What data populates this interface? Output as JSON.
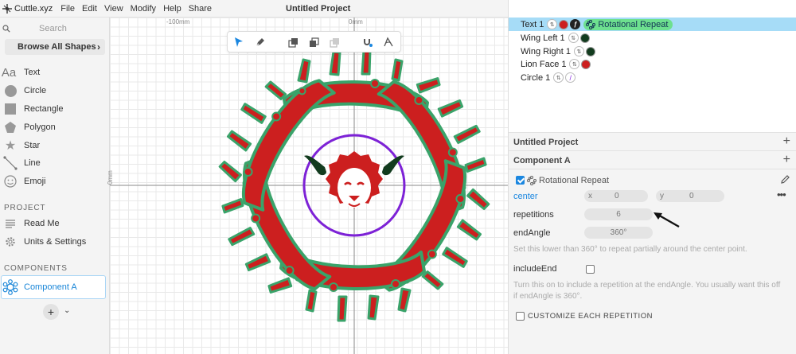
{
  "app": {
    "brand": "Cuttle.xyz",
    "menus": [
      "File",
      "Edit",
      "View",
      "Modify",
      "Help",
      "Share"
    ],
    "project_title": "Untitled Project"
  },
  "sidebar": {
    "search_placeholder": "Search",
    "browse_label": "Browse All Shapes",
    "shapes": [
      {
        "label": "Text",
        "icon": "text-aa-icon"
      },
      {
        "label": "Circle",
        "icon": "circle-icon"
      },
      {
        "label": "Rectangle",
        "icon": "rectangle-icon"
      },
      {
        "label": "Polygon",
        "icon": "polygon-icon"
      },
      {
        "label": "Star",
        "icon": "star-icon"
      },
      {
        "label": "Line",
        "icon": "line-icon"
      },
      {
        "label": "Emoji",
        "icon": "emoji-icon"
      }
    ],
    "project_header": "PROJECT",
    "project_items": [
      {
        "label": "Read Me",
        "icon": "document-icon"
      },
      {
        "label": "Units & Settings",
        "icon": "gear-icon"
      }
    ],
    "components_header": "COMPONENTS",
    "component": {
      "label": "Component A",
      "icon": "component-icon"
    }
  },
  "canvas": {
    "ruler_labels": [
      "-100mm",
      "0mm"
    ],
    "side_label": "0mm"
  },
  "layers": [
    {
      "name": "Text 1",
      "selected": true,
      "colors": [
        "#cc1f1f"
      ],
      "has_script": true,
      "badge": "Rotational Repeat"
    },
    {
      "name": "Wing Left 1",
      "selected": false,
      "colors": [
        "#123b1e"
      ]
    },
    {
      "name": "Wing Right 1",
      "selected": false,
      "colors": [
        "#123b1e"
      ]
    },
    {
      "name": "Lion Face 1",
      "selected": false,
      "colors": [
        "#cc1f1f"
      ]
    },
    {
      "name": "Circle 1",
      "selected": false,
      "colors": [
        "#8a2be2"
      ]
    }
  ],
  "panel": {
    "untitled_project": "Untitled Project",
    "component_a": "Component A",
    "modifier_name": "Rotational Repeat",
    "center_label": "center",
    "center_x_label": "x",
    "center_x_value": "0",
    "center_y_label": "y",
    "center_y_value": "0",
    "repetitions_label": "repetitions",
    "repetitions_value": "6",
    "end_angle_label": "endAngle",
    "end_angle_value": "360°",
    "end_angle_hint": "Set this lower than 360° to repeat partially around the center point.",
    "include_end_label": "includeEnd",
    "include_end_hint": "Turn this on to include a repetition at the endAngle. You usually want this off if endAngle is 360°.",
    "customize_label": "CUSTOMIZE EACH REPETITION"
  },
  "colors": {
    "accent": "#1b87e0",
    "selected_row": "#a6dcf7",
    "badge": "#6de08f",
    "text_red": "#cc1f1f",
    "outline_green": "#3aa36a",
    "circle_purple": "#7d22d6"
  }
}
